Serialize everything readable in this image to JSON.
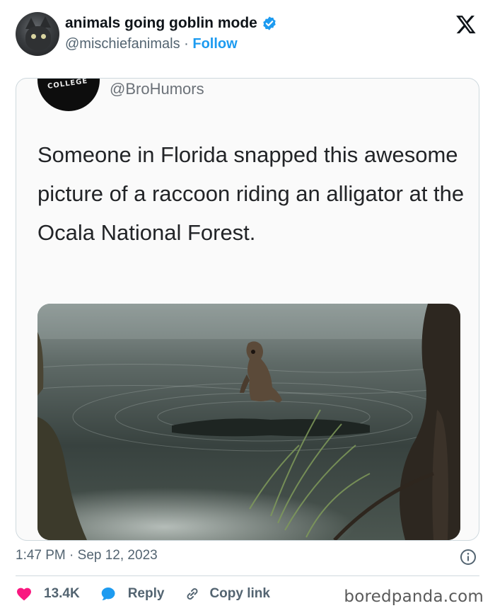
{
  "author": {
    "display_name": "animals going goblin mode",
    "handle": "@mischiefanimals",
    "separator": "·",
    "follow_label": "Follow",
    "avatar_icon": "cat-avatar",
    "verified_icon": "verified-badge-icon",
    "verified_color": "#1d9bf0"
  },
  "platform": {
    "logo_icon": "x-logo-icon"
  },
  "quoted_post": {
    "avatar_text": "COLLEGE",
    "handle": "@BroHumors",
    "text": "Someone in Florida snapped this awesome picture of a raccoon riding an alligator at the Ocala National Forest.",
    "image_icon": "raccoon-on-alligator-photo"
  },
  "post_meta": {
    "time": "1:47 PM",
    "separator": "·",
    "date": "Sep 12, 2023",
    "info_icon": "info-icon"
  },
  "actions": {
    "like_count": "13.4K",
    "like_color": "#f91880",
    "reply_label": "Reply",
    "reply_color": "#1d9bf0",
    "copy_label": "Copy link"
  },
  "watermark": "boredpanda.com"
}
